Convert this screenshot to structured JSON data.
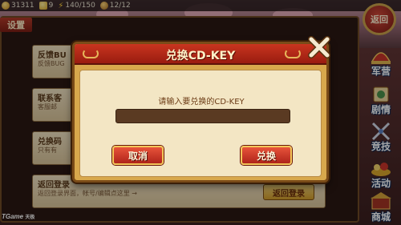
{
  "topbar": {
    "coins": "31311",
    "gold": "9",
    "stamina": "140/150",
    "tokens": "12/12"
  },
  "side_menu": {
    "back_label": "返回",
    "items": [
      {
        "label": "军营",
        "icon": "helmet-icon"
      },
      {
        "label": "剧情",
        "icon": "scroll-icon"
      },
      {
        "label": "竞技",
        "icon": "crossed-swords-icon"
      },
      {
        "label": "活动",
        "icon": "treasure-icon"
      },
      {
        "label": "商城",
        "icon": "shop-icon"
      }
    ]
  },
  "settings": {
    "title": "设置",
    "rows": [
      {
        "title": "反馈BU",
        "desc": "反馈BUG"
      },
      {
        "title": "联系客",
        "desc": "客服邮"
      },
      {
        "title": "兑换码",
        "desc": "只有有"
      },
      {
        "title": "返回登录",
        "desc": "返回登录界面，帐号/编辑点这里 →"
      }
    ],
    "return_login_label": "返回登录"
  },
  "dialog": {
    "title": "兑换CD-KEY",
    "prompt": "请输入要兑换的CD-KEY",
    "input_value": "",
    "cancel_label": "取消",
    "confirm_label": "兑换"
  },
  "watermark": {
    "brand": "TGame",
    "suffix": "天极"
  },
  "colors": {
    "dialog_header": "#b52a19",
    "dialog_frame": "#d8a84c",
    "button_red": "#c9331f",
    "input_bg": "#5a3a22"
  }
}
